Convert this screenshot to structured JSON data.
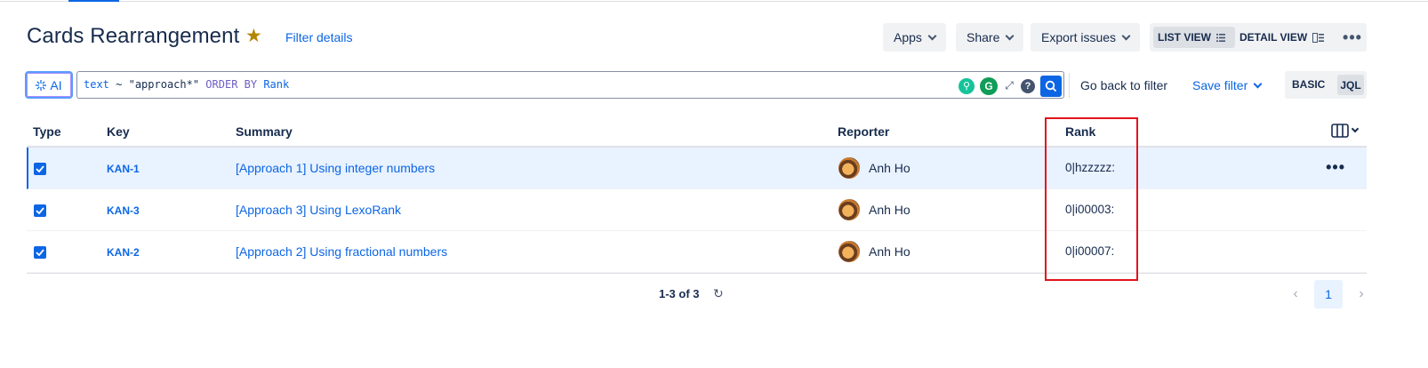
{
  "header": {
    "title": "Cards Rearrangement",
    "filter_details": "Filter details",
    "apps": "Apps",
    "share": "Share",
    "export": "Export issues",
    "list_view": "LIST VIEW",
    "detail_view": "DETAIL VIEW",
    "more": "•••"
  },
  "search": {
    "ai_label": "AI",
    "jql_field": "text",
    "jql_op": " ~ ",
    "jql_value": "\"approach*\"",
    "jql_order": " ORDER BY ",
    "jql_order_field": "Rank",
    "go_back": "Go back to filter",
    "save_filter": "Save filter",
    "basic": "BASIC",
    "jql": "JQL"
  },
  "table": {
    "columns": {
      "type": "Type",
      "key": "Key",
      "summary": "Summary",
      "reporter": "Reporter",
      "rank": "Rank"
    },
    "rows": [
      {
        "key": "KAN-1",
        "summary": "[Approach 1] Using integer numbers",
        "reporter": "Anh Ho",
        "rank": "0|hzzzzz:"
      },
      {
        "key": "KAN-3",
        "summary": "[Approach 3] Using LexoRank",
        "reporter": "Anh Ho",
        "rank": "0|i00003:"
      },
      {
        "key": "KAN-2",
        "summary": "[Approach 2] Using fractional numbers",
        "reporter": "Anh Ho",
        "rank": "0|i00007:"
      }
    ]
  },
  "footer": {
    "count": "1-3 of 3",
    "current_page": "1"
  },
  "colors": {
    "accent": "#0c66e4",
    "highlight": "#e2141c",
    "selected_row": "#e9f2ff"
  }
}
